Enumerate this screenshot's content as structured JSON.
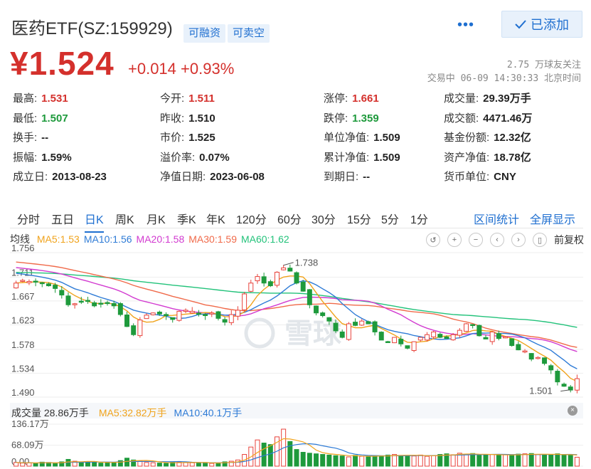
{
  "header": {
    "title": "医药ETF(SZ:159929)",
    "badges": [
      "可融资",
      "可卖空"
    ],
    "more": "•••",
    "add_label": "已添加",
    "price": "¥1.524",
    "change": "+0.014",
    "change_pct": "+0.93%",
    "followers": "2.75 万球友关注",
    "trade_time": "交易中 06-09 14:30:33 北京时间"
  },
  "stats": [
    [
      {
        "k": "最高:",
        "v": "1.531",
        "c": "up"
      },
      {
        "k": "今开:",
        "v": "1.511",
        "c": "up"
      },
      {
        "k": "涨停:",
        "v": "1.661",
        "c": "up"
      },
      {
        "k": "成交量:",
        "v": "29.39万手",
        "c": ""
      }
    ],
    [
      {
        "k": "最低:",
        "v": "1.507",
        "c": "down"
      },
      {
        "k": "昨收:",
        "v": "1.510",
        "c": ""
      },
      {
        "k": "跌停:",
        "v": "1.359",
        "c": "down"
      },
      {
        "k": "成交额:",
        "v": "4471.46万",
        "c": ""
      }
    ],
    [
      {
        "k": "换手:",
        "v": "--",
        "c": ""
      },
      {
        "k": "市价:",
        "v": "1.525",
        "c": ""
      },
      {
        "k": "单位净值:",
        "v": "1.509",
        "c": ""
      },
      {
        "k": "基金份额:",
        "v": "12.32亿",
        "c": ""
      }
    ],
    [
      {
        "k": "振幅:",
        "v": "1.59%",
        "c": ""
      },
      {
        "k": "溢价率:",
        "v": "0.07%",
        "c": ""
      },
      {
        "k": "累计净值:",
        "v": "1.509",
        "c": ""
      },
      {
        "k": "资产净值:",
        "v": "18.78亿",
        "c": ""
      }
    ],
    [
      {
        "k": "成立日:",
        "v": "2013-08-23",
        "c": ""
      },
      {
        "k": "净值日期:",
        "v": "2023-06-08",
        "c": ""
      },
      {
        "k": "到期日:",
        "v": "--",
        "c": ""
      },
      {
        "k": "货币单位:",
        "v": "CNY",
        "c": ""
      }
    ]
  ],
  "tabs": [
    "分时",
    "五日",
    "日K",
    "周K",
    "月K",
    "季K",
    "年K",
    "120分",
    "60分",
    "30分",
    "15分",
    "5分",
    "1分"
  ],
  "active_tab": "日K",
  "tab_links": [
    "区间统计",
    "全屏显示"
  ],
  "ma_legend": {
    "label": "均线",
    "items": [
      {
        "text": "MA5:1.53",
        "color": "#f0a31c"
      },
      {
        "text": "MA10:1.56",
        "color": "#2e7bd6"
      },
      {
        "text": "MA20:1.58",
        "color": "#d23ad0"
      },
      {
        "text": "MA30:1.59",
        "color": "#f06a4a"
      },
      {
        "text": "MA60:1.62",
        "color": "#22c27a"
      }
    ],
    "restore_label": "前复权"
  },
  "vol_legend": {
    "label": "成交量 28.86万手",
    "items": [
      {
        "text": "MA5:32.82万手",
        "color": "#f0a31c"
      },
      {
        "text": "MA10:40.1万手",
        "color": "#2e7bd6"
      }
    ]
  },
  "colors": {
    "up": "#e8433c",
    "down": "#1e9a3c",
    "accent": "#1f6fd0"
  },
  "chart_data": {
    "type": "candlestick",
    "y_ticks": [
      "1.756",
      "1.711",
      "1.667",
      "1.623",
      "1.578",
      "1.534",
      "1.490"
    ],
    "ylim": [
      1.49,
      1.756
    ],
    "max_label": "1.738",
    "min_label": "1.501",
    "closes": [
      1.7,
      1.705,
      1.703,
      1.702,
      1.699,
      1.695,
      1.69,
      1.678,
      1.66,
      1.662,
      1.665,
      1.667,
      1.658,
      1.661,
      1.663,
      1.658,
      1.642,
      1.62,
      1.605,
      1.632,
      1.641,
      1.645,
      1.643,
      1.64,
      1.633,
      1.648,
      1.65,
      1.648,
      1.643,
      1.64,
      1.645,
      1.635,
      1.628,
      1.642,
      1.65,
      1.68,
      1.7,
      1.712,
      1.7,
      1.695,
      1.72,
      1.728,
      1.722,
      1.7,
      1.685,
      1.66,
      1.645,
      1.64,
      1.63,
      1.612,
      1.6,
      1.625,
      1.622,
      1.63,
      1.625,
      1.61,
      1.595,
      1.592,
      1.6,
      1.588,
      1.58,
      1.592,
      1.6,
      1.605,
      1.61,
      1.6,
      1.598,
      1.605,
      1.613,
      1.625,
      1.622,
      1.603,
      1.597,
      1.61,
      1.598,
      1.601,
      1.585,
      1.577,
      1.575,
      1.56,
      1.563,
      1.552,
      1.54,
      1.518,
      1.51,
      1.503,
      1.524
    ],
    "volume_ticks": [
      "136.17万",
      "68.09万",
      "0.00"
    ],
    "vol_max": 136.17,
    "volumes": [
      12,
      10,
      11,
      9,
      13,
      12,
      8,
      14,
      22,
      16,
      11,
      13,
      15,
      10,
      12,
      11,
      18,
      26,
      20,
      16,
      12,
      11,
      10,
      9,
      13,
      14,
      12,
      11,
      10,
      12,
      9,
      10,
      14,
      16,
      20,
      38,
      62,
      85,
      75,
      70,
      95,
      120,
      80,
      54,
      45,
      42,
      40,
      38,
      36,
      34,
      33,
      30,
      35,
      32,
      31,
      34,
      33,
      36,
      38,
      34,
      35,
      33,
      36,
      32,
      34,
      38,
      40,
      37,
      42,
      39,
      41,
      35,
      36,
      38,
      36,
      37,
      35,
      39,
      40,
      41,
      38,
      36,
      37,
      40,
      36,
      38,
      29
    ]
  }
}
